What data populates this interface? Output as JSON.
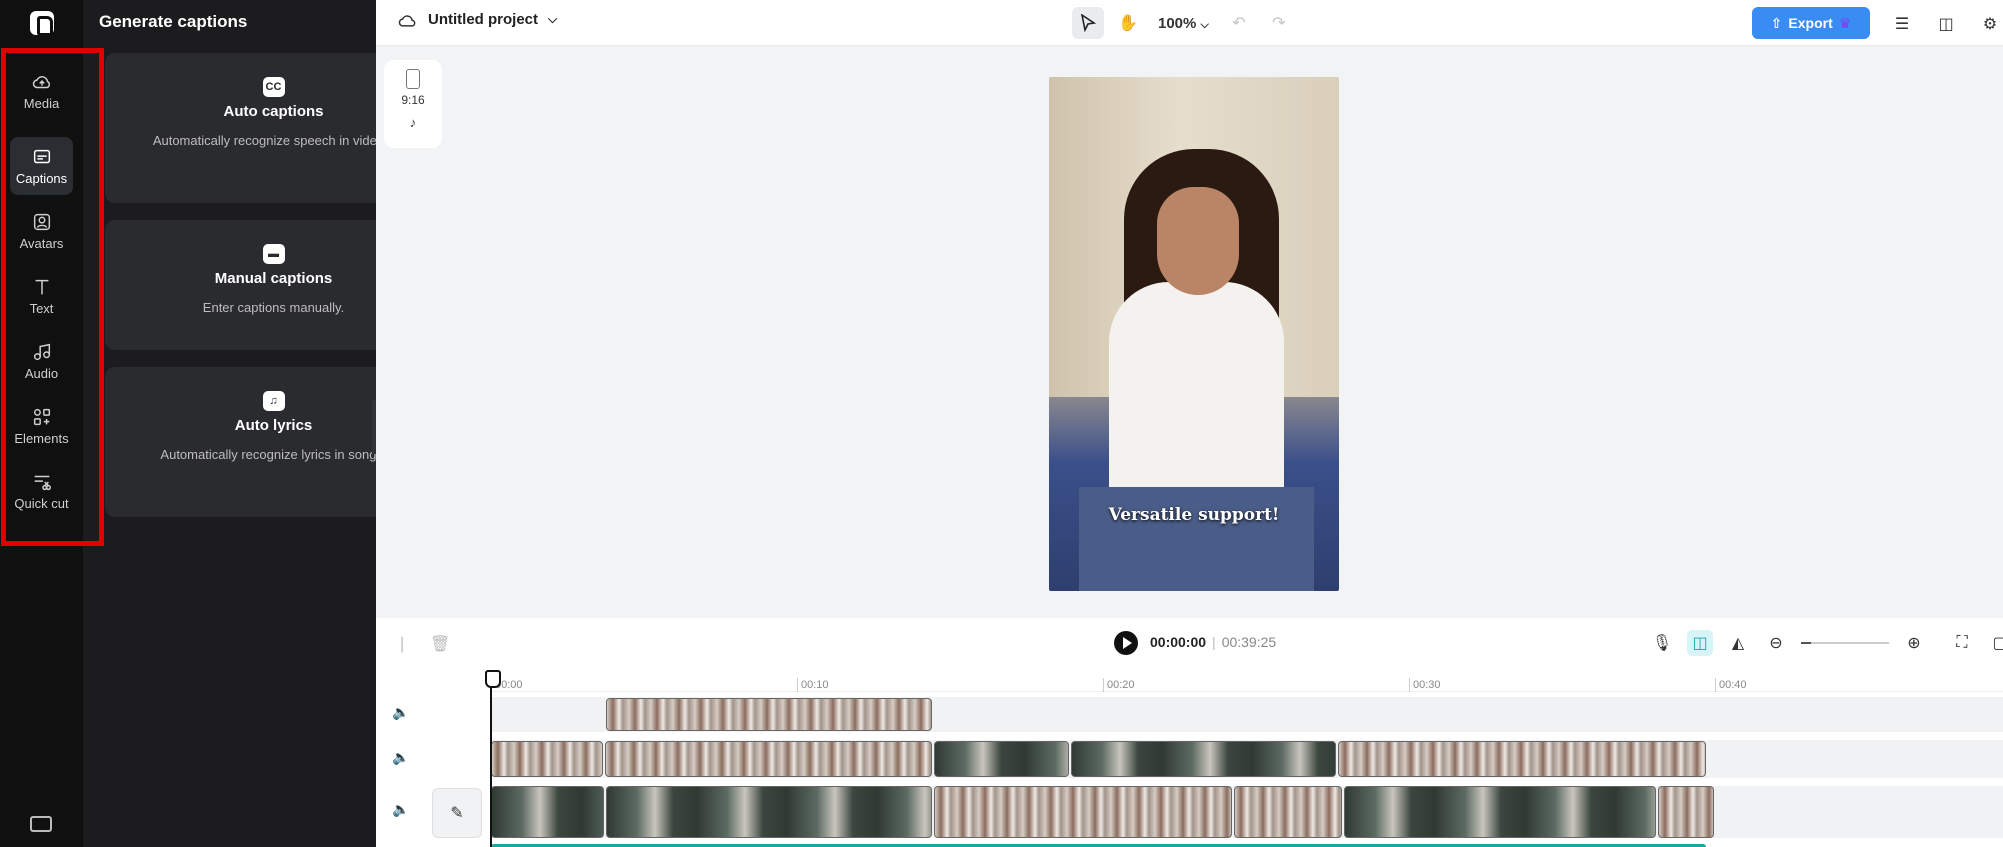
{
  "rail": {
    "items": [
      {
        "label": "Media",
        "icon": "cloud-upload-icon"
      },
      {
        "label": "Captions",
        "icon": "captions-icon",
        "active": true
      },
      {
        "label": "Avatars",
        "icon": "avatar-icon"
      },
      {
        "label": "Text",
        "icon": "text-icon"
      },
      {
        "label": "Audio",
        "icon": "music-note-icon"
      },
      {
        "label": "Elements",
        "icon": "elements-icon"
      },
      {
        "label": "Quick cut",
        "icon": "quick-cut-icon"
      }
    ]
  },
  "panel": {
    "title": "Generate captions",
    "cards": [
      {
        "icon": "cc-icon",
        "icon_glyph": "CC",
        "title": "Auto captions",
        "desc": "Automatically recognize speech in videos."
      },
      {
        "icon": "subtitles-icon",
        "icon_glyph": "▬",
        "title": "Manual captions",
        "desc": "Enter captions manually."
      },
      {
        "icon": "lyrics-icon",
        "icon_glyph": "♫",
        "title": "Auto lyrics",
        "desc": "Automatically recognize lyrics in songs."
      }
    ]
  },
  "topbar": {
    "project_name": "Untitled project",
    "zoom": "100%",
    "export_label": "Export"
  },
  "canvas": {
    "ratio_label": "9:16",
    "caption_text": "Versatile support!"
  },
  "playback": {
    "current_time": "00:00:00",
    "separator": "|",
    "total_time": "00:39:25"
  },
  "timeline": {
    "ticks": [
      "00:00",
      "00:10",
      "00:20",
      "00:30",
      "00:40"
    ]
  },
  "colors": {
    "accent": "#3a8bf3",
    "highlight": "#e00000",
    "panel_bg": "#1c1c1e"
  }
}
